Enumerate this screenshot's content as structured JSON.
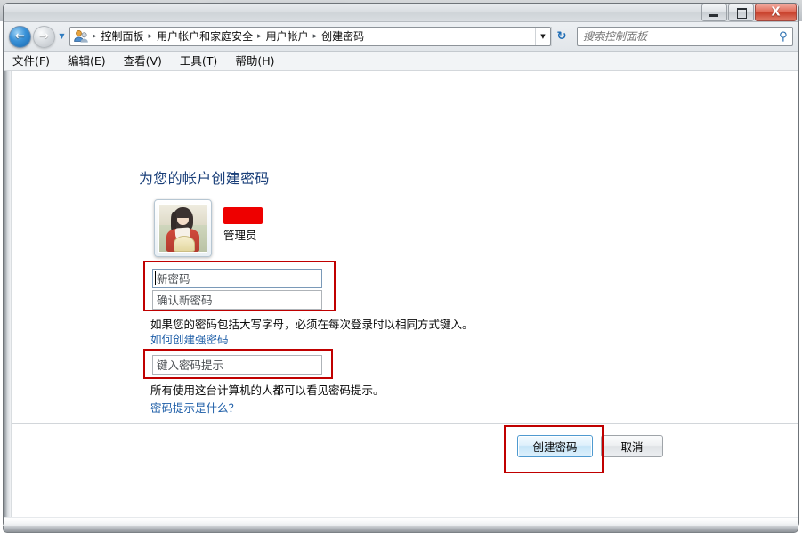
{
  "window": {
    "controls": {
      "minimize_label": "–",
      "maximize_label": "□",
      "close_label": "X"
    }
  },
  "background_tabs": [
    {
      "title_blurred": true
    },
    {
      "title_blurred": true
    }
  ],
  "toolbar": {
    "back_arrow": "←",
    "forward_arrow": "→",
    "history_chevron": "▼",
    "address_dropdown": "▼",
    "refresh_glyph": "↻",
    "search_icon": "⚲"
  },
  "address": {
    "icon_name": "user-accounts-icon",
    "separator": "▸",
    "crumbs": [
      "控制面板",
      "用户帐户和家庭安全",
      "用户帐户",
      "创建密码"
    ]
  },
  "search": {
    "placeholder": "搜索控制面板",
    "value": ""
  },
  "menubar": {
    "items": [
      "文件(F)",
      "编辑(E)",
      "查看(V)",
      "工具(T)",
      "帮助(H)"
    ]
  },
  "main": {
    "page_title": "为您的帐户创建密码",
    "account": {
      "avatar_name": "user-avatar-picture",
      "username_redacted": true,
      "role": "管理员"
    },
    "form": {
      "new_password": {
        "placeholder": "新密码",
        "value": "",
        "focused": true
      },
      "confirm_password": {
        "placeholder": "确认新密码",
        "value": "",
        "focused": false
      },
      "caps_note": "如果您的密码包括大写字母，必须在每次登录时以相同方式键入。",
      "strong_password_link": "如何创建强密码",
      "hint": {
        "placeholder": "键入密码提示",
        "value": ""
      },
      "hint_note": "所有使用这台计算机的人都可以看见密码提示。",
      "hint_link": "密码提示是什么？"
    },
    "actions": {
      "submit_label": "创建密码",
      "cancel_label": "取消"
    }
  },
  "annotations": {
    "color": "#c00000",
    "boxes": [
      {
        "name": "password-fields-highlight"
      },
      {
        "name": "hint-field-highlight"
      },
      {
        "name": "create-password-button-highlight"
      }
    ],
    "redaction_color": "#ee0000"
  }
}
